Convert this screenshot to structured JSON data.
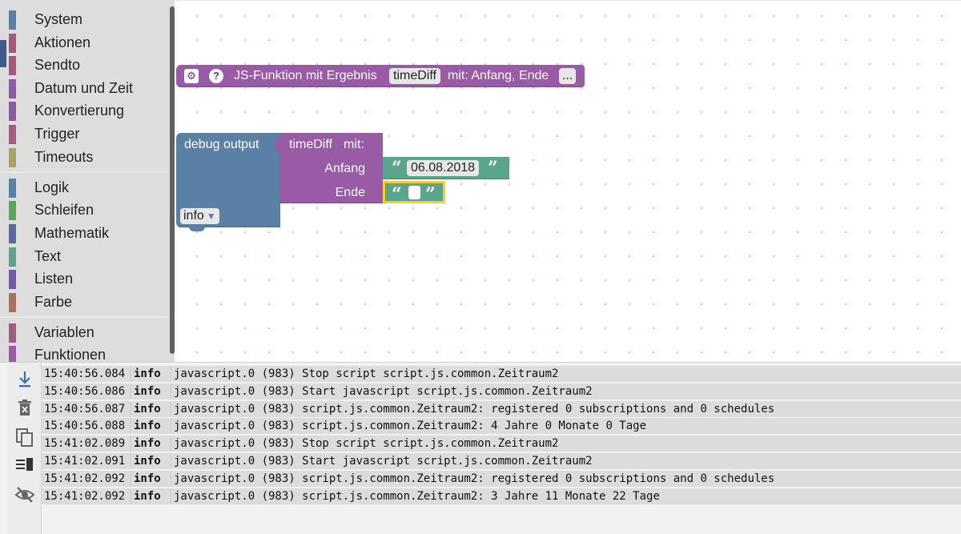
{
  "toolbox": {
    "groups": [
      [
        {
          "label": "System",
          "color": "#5b80a5"
        },
        {
          "label": "Aktionen",
          "color": "#a5577d"
        },
        {
          "label": "Sendto",
          "color": "#a5577d"
        },
        {
          "label": "Datum und Zeit",
          "color": "#8d5ba5"
        },
        {
          "label": "Konvertierung",
          "color": "#8d5ba5"
        },
        {
          "label": "Trigger",
          "color": "#a55b80"
        },
        {
          "label": "Timeouts",
          "color": "#a5a55b"
        }
      ],
      [
        {
          "label": "Logik",
          "color": "#5b80a5"
        },
        {
          "label": "Schleifen",
          "color": "#5ba55b"
        },
        {
          "label": "Mathematik",
          "color": "#5b67a5"
        },
        {
          "label": "Text",
          "color": "#5ba58c"
        },
        {
          "label": "Listen",
          "color": "#745ba5"
        },
        {
          "label": "Farbe",
          "color": "#a5745b"
        }
      ],
      [
        {
          "label": "Variablen",
          "color": "#a55b80"
        },
        {
          "label": "Funktionen",
          "color": "#995ba5"
        }
      ]
    ]
  },
  "workspace": {
    "function_block": {
      "gear_icon": "gear-icon",
      "help_icon": "help-icon",
      "help_glyph": "?",
      "label": "JS-Funktion mit Ergebnis",
      "name": "timeDiff",
      "params": "mit: Anfang, Ende",
      "more": "...",
      "color": "#995ba5"
    },
    "debug_block": {
      "label": "debug output",
      "level": "info",
      "color": "#5b80a5"
    },
    "call_block": {
      "name": "timeDiff",
      "mit_label": "mit:",
      "arg1_label": "Anfang",
      "arg2_label": "Ende"
    },
    "string_block_start": {
      "value": "06.08.2018",
      "color": "#5ba58c"
    },
    "string_block_end": {
      "value": "",
      "highlight": "#ffcc33"
    }
  },
  "log": {
    "tools": [
      "scroll-down-icon",
      "trash-icon",
      "copy-icon",
      "layout-icon",
      "eye-off-icon"
    ],
    "rows": [
      {
        "time": "15:40:56.084",
        "level": "info",
        "message": "javascript.0 (983) Stop script script.js.common.Zeitraum2"
      },
      {
        "time": "15:40:56.086",
        "level": "info",
        "message": "javascript.0 (983) Start javascript script.js.common.Zeitraum2"
      },
      {
        "time": "15:40:56.087",
        "level": "info",
        "message": "javascript.0 (983) script.js.common.Zeitraum2: registered 0 subscriptions and 0 schedules"
      },
      {
        "time": "15:40:56.088",
        "level": "info",
        "message": "javascript.0 (983) script.js.common.Zeitraum2: 4 Jahre 0 Monate 0 Tage"
      },
      {
        "time": "15:41:02.089",
        "level": "info",
        "message": "javascript.0 (983) Stop script script.js.common.Zeitraum2"
      },
      {
        "time": "15:41:02.091",
        "level": "info",
        "message": "javascript.0 (983) Start javascript script.js.common.Zeitraum2"
      },
      {
        "time": "15:41:02.092",
        "level": "info",
        "message": "javascript.0 (983) script.js.common.Zeitraum2: registered 0 subscriptions and 0 schedules"
      },
      {
        "time": "15:41:02.092",
        "level": "info",
        "message": "javascript.0 (983) script.js.common.Zeitraum2: 3 Jahre 11 Monate 22 Tage"
      }
    ]
  }
}
